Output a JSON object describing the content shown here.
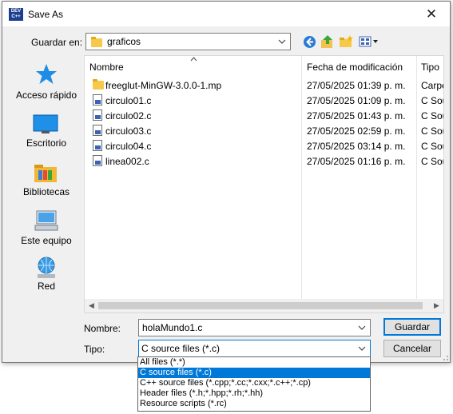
{
  "window": {
    "title": "Save As",
    "app_icon_text": "DEV C++",
    "close_glyph": "✕"
  },
  "location": {
    "label": "Guardar en:",
    "current_folder": "graficos",
    "folder_icon": "folder-icon"
  },
  "toolbar": {
    "back_icon": "back-icon",
    "up_icon": "up-folder-icon",
    "new_folder_icon": "new-folder-icon",
    "view_menu_icon": "view-menu-icon"
  },
  "places": [
    {
      "label": "Acceso rápido",
      "icon": "star-icon"
    },
    {
      "label": "Escritorio",
      "icon": "desktop-icon"
    },
    {
      "label": "Bibliotecas",
      "icon": "libraries-icon"
    },
    {
      "label": "Este equipo",
      "icon": "computer-icon"
    },
    {
      "label": "Red",
      "icon": "network-icon"
    }
  ],
  "file_list": {
    "columns": [
      "Nombre",
      "Fecha de modificación",
      "Tipo"
    ],
    "rows": [
      {
        "name": "freeglut-MinGW-3.0.0-1.mp",
        "date": "27/05/2025 01:39 p. m.",
        "type": "Carpe",
        "icon": "folder-icon"
      },
      {
        "name": "circulo01.c",
        "date": "27/05/2025 01:09 p. m.",
        "type": "C Sou",
        "icon": "c-source-file-icon"
      },
      {
        "name": "circulo02.c",
        "date": "27/05/2025 01:43 p. m.",
        "type": "C Sou",
        "icon": "c-source-file-icon"
      },
      {
        "name": "circulo03.c",
        "date": "27/05/2025 02:59 p. m.",
        "type": "C Sou",
        "icon": "c-source-file-icon"
      },
      {
        "name": "circulo04.c",
        "date": "27/05/2025 03:14 p. m.",
        "type": "C Sou",
        "icon": "c-source-file-icon"
      },
      {
        "name": "linea002.c",
        "date": "27/05/2025 01:16 p. m.",
        "type": "C Sou",
        "icon": "c-source-file-icon"
      }
    ]
  },
  "form": {
    "name_label": "Nombre:",
    "name_value": "holaMundo1.c",
    "type_label": "Tipo:",
    "type_value": "C source files (*.c)"
  },
  "buttons": {
    "save": "Guardar",
    "cancel": "Cancelar"
  },
  "type_dropdown": {
    "options": [
      "All files (*.*)",
      "C source files (*.c)",
      "C++ source files (*.cpp;*.cc;*.cxx;*.c++;*.cp)",
      "Header files (*.h;*.hpp;*.rh;*.hh)",
      "Resource scripts (*.rc)"
    ],
    "selected_index": 1
  },
  "colors": {
    "accent": "#0078d7",
    "dialog_bg": "#f0f0f0",
    "folder": "#f6c94a"
  }
}
